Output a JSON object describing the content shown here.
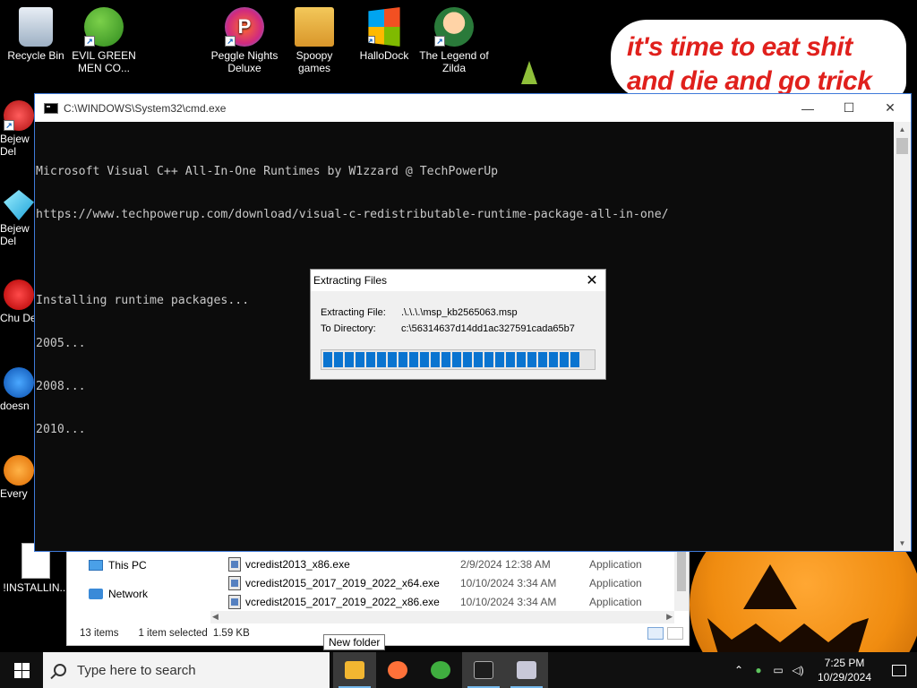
{
  "desktop": {
    "icons": [
      {
        "label": "Recycle Bin",
        "icon": "recycle-bin-icon"
      },
      {
        "label": "EVIL GREEN MEN CO...",
        "icon": "evil-green-men-icon"
      },
      {
        "label": "Peggle Nights Deluxe",
        "icon": "peggle-icon"
      },
      {
        "label": "Spoopy games",
        "icon": "folder-icon"
      },
      {
        "label": "HalloDock",
        "icon": "windows-logo-icon"
      },
      {
        "label": "The Legend of Zilda",
        "icon": "zelda-icon"
      }
    ],
    "left_icons": [
      {
        "label": "Bejew Del",
        "icon": "bejeweled-icon"
      },
      {
        "label": "Bejew Del",
        "icon": "bejeweled-gem-icon"
      },
      {
        "label": "Chu Del",
        "icon": "chuzzle-icon"
      },
      {
        "label": "doesn",
        "icon": "sonic-icon"
      },
      {
        "label": "Every",
        "icon": "everything-icon"
      },
      {
        "label": "!INSTALLIN...",
        "icon": "text-file-icon"
      }
    ],
    "speech_text": [
      "it's time to eat shit",
      "and die and go trick"
    ]
  },
  "cmd": {
    "title": "C:\\WINDOWS\\System32\\cmd.exe",
    "lines": [
      "Microsoft Visual C++ All-In-One Runtimes by W1zzard @ TechPowerUp",
      "https://www.techpowerup.com/download/visual-c-redistributable-runtime-package-all-in-one/",
      "",
      "Installing runtime packages...",
      "2005...",
      "2008...",
      "2010..."
    ]
  },
  "extract_dialog": {
    "title": "Extracting Files",
    "file_label": "Extracting File:",
    "file_value": ".\\.\\.\\.\\msp_kb2565063.msp",
    "dir_label": "To Directory:",
    "dir_value": "c:\\56314637d14dd1ac327591cada65b7",
    "progress": 1.0,
    "segments": 24
  },
  "explorer": {
    "nav": [
      {
        "label": "This PC",
        "icon": "this-pc-icon"
      },
      {
        "label": "Network",
        "icon": "network-icon"
      }
    ],
    "files": [
      {
        "name": "vcredist2013_x86.exe",
        "date": "2/9/2024 12:38 AM",
        "type": "Application"
      },
      {
        "name": "vcredist2015_2017_2019_2022_x64.exe",
        "date": "10/10/2024 3:34 AM",
        "type": "Application"
      },
      {
        "name": "vcredist2015_2017_2019_2022_x86.exe",
        "date": "10/10/2024 3:34 AM",
        "type": "Application"
      }
    ],
    "status_items": "13 items",
    "status_selected": "1 item selected",
    "status_size": "1.59 KB"
  },
  "tooltip": "New folder",
  "taskbar": {
    "search_placeholder": "Type here to search",
    "apps": [
      {
        "name": "file-explorer",
        "color": "#f2b631"
      },
      {
        "name": "firefox",
        "color": "#ff7139"
      },
      {
        "name": "evil-green-men",
        "color": "#3fae3f"
      },
      {
        "name": "command-prompt",
        "color": "#1e1e1e"
      },
      {
        "name": "installer",
        "color": "#c8c8d8"
      }
    ],
    "time": "7:25 PM",
    "date": "10/29/2024"
  }
}
